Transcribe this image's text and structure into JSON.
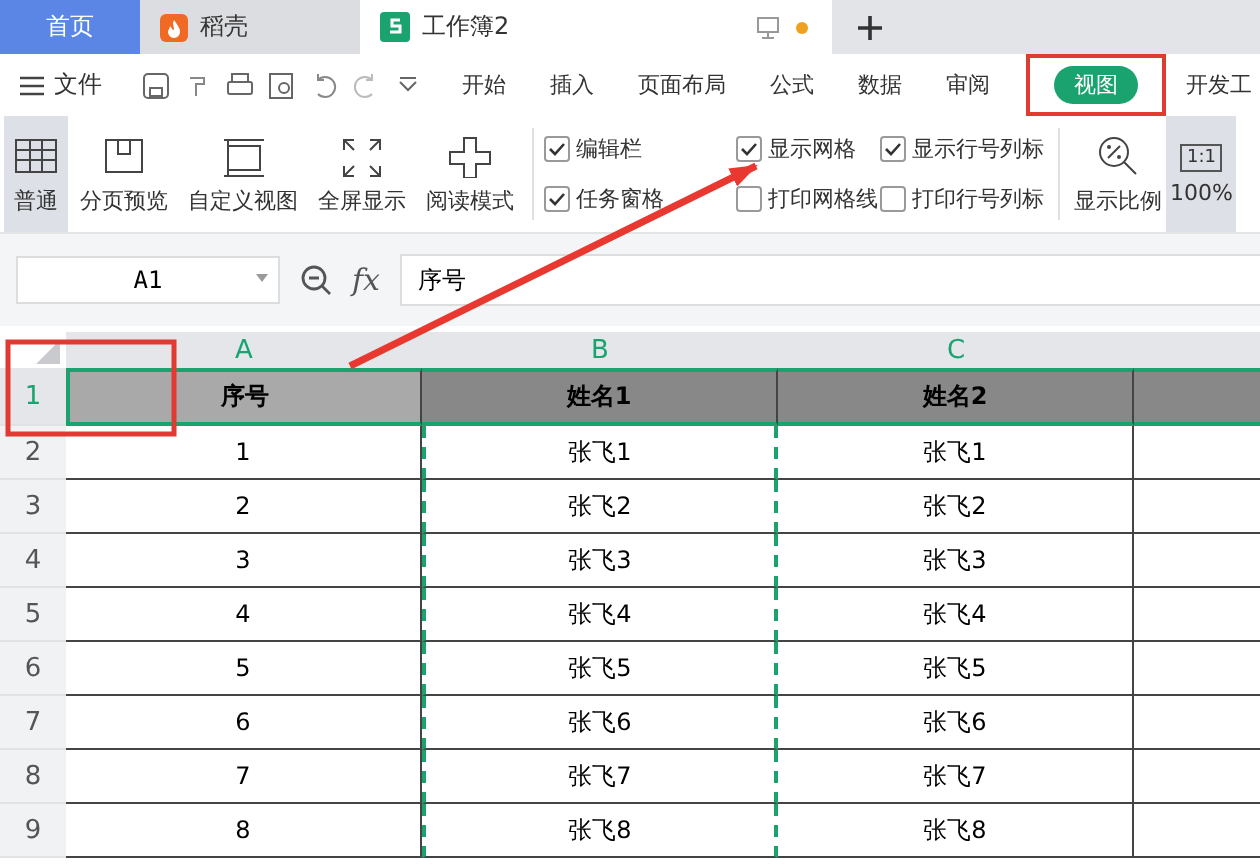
{
  "window_tabs": [
    {
      "label": "首页",
      "kind": "home",
      "selected": false
    },
    {
      "label": "稻壳",
      "kind": "docer",
      "selected": false
    },
    {
      "label": "工作簿2",
      "kind": "sheet",
      "selected": true
    }
  ],
  "menu": {
    "file": "文件",
    "tabs": [
      {
        "label": "开始",
        "selected": false
      },
      {
        "label": "插入",
        "selected": false
      },
      {
        "label": "页面布局",
        "selected": false
      },
      {
        "label": "公式",
        "selected": false
      },
      {
        "label": "数据",
        "selected": false
      },
      {
        "label": "审阅",
        "selected": false
      },
      {
        "label": "视图",
        "selected": true
      },
      {
        "label": "开发工",
        "selected": false
      }
    ]
  },
  "ribbon": {
    "views": [
      {
        "label": "普通",
        "kind": "grid",
        "selected": true
      },
      {
        "label": "分页预览",
        "kind": "page",
        "selected": false
      },
      {
        "label": "自定义视图",
        "kind": "custom",
        "selected": false
      },
      {
        "label": "全屏显示",
        "kind": "full",
        "selected": false
      },
      {
        "label": "阅读模式",
        "kind": "read",
        "selected": false
      }
    ],
    "options": [
      {
        "label": "编辑栏",
        "checked": true
      },
      {
        "label": "任务窗格",
        "checked": true
      },
      {
        "label": "显示网格",
        "checked": true
      },
      {
        "label": "打印网格线",
        "checked": false
      },
      {
        "label": "显示行号列标",
        "checked": true
      },
      {
        "label": "打印行号列标",
        "checked": false
      }
    ],
    "zoom_label": "显示比例",
    "zoom_value": "100%",
    "zoom_badge": "1:1"
  },
  "formula_bar": {
    "cell": "A1",
    "fx": "fx",
    "value": "序号"
  },
  "sheet": {
    "columns": [
      "A",
      "B",
      "C"
    ],
    "header_row": {
      "number": "1",
      "cells": [
        "序号",
        "姓名1",
        "姓名2"
      ]
    },
    "rows": [
      {
        "number": "2",
        "cells": [
          "1",
          "张飞1",
          "张飞1"
        ]
      },
      {
        "number": "3",
        "cells": [
          "2",
          "张飞2",
          "张飞2"
        ]
      },
      {
        "number": "4",
        "cells": [
          "3",
          "张飞3",
          "张飞3"
        ]
      },
      {
        "number": "5",
        "cells": [
          "4",
          "张飞4",
          "张飞4"
        ]
      },
      {
        "number": "6",
        "cells": [
          "5",
          "张飞5",
          "张飞5"
        ]
      },
      {
        "number": "7",
        "cells": [
          "6",
          "张飞6",
          "张飞6"
        ]
      },
      {
        "number": "8",
        "cells": [
          "7",
          "张飞7",
          "张飞7"
        ]
      },
      {
        "number": "9",
        "cells": [
          "8",
          "张飞8",
          "张飞8"
        ]
      }
    ]
  }
}
